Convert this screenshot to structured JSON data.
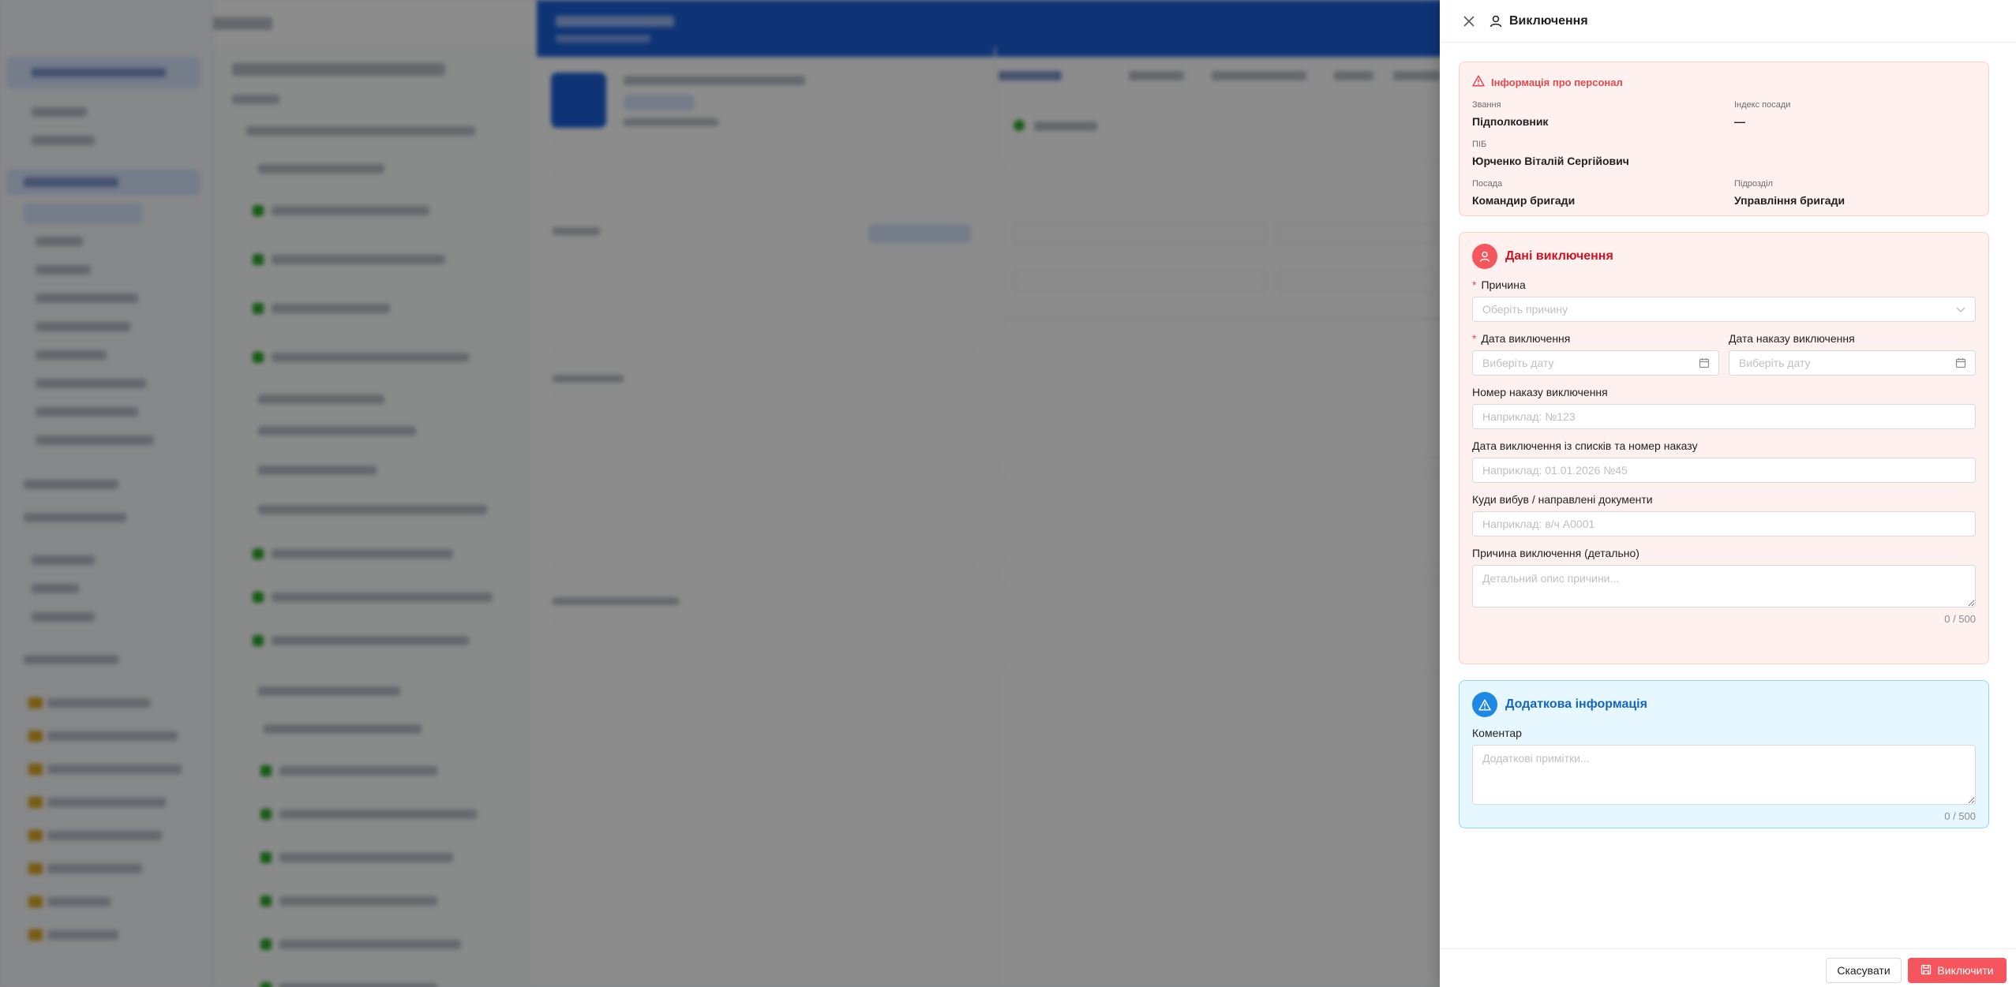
{
  "drawer": {
    "title": "Виключення",
    "personnel": {
      "heading": "Інформація про персонал",
      "rank_label": "Звання",
      "rank_value": "Підполковник",
      "position_index_label": "Індекс посади",
      "position_index_value": "—",
      "name_label": "ПІБ",
      "name_value": "Юрченко Віталій Сергійович",
      "position_label": "Посада",
      "position_value": "Командир бригади",
      "unit_label": "Підрозділ",
      "unit_value": "Управління бригади"
    },
    "exclusion": {
      "heading": "Дані виключення",
      "reason_label": "Причина",
      "reason_placeholder": "Оберіть причину",
      "date_label": "Дата виключення",
      "date_placeholder": "Виберіть дату",
      "order_date_label": "Дата наказу виключення",
      "order_date_placeholder": "Виберіть дату",
      "order_number_label": "Номер наказу виключення",
      "order_number_placeholder": "Наприклад: №123",
      "list_date_label": "Дата виключення із списків та номер наказу",
      "list_date_placeholder": "Наприклад: 01.01.2026 №45",
      "destination_label": "Куди вибув / направлені документи",
      "destination_placeholder": "Наприклад: в/ч А0001",
      "detail_label": "Причина виключення (детально)",
      "detail_placeholder": "Детальний опис причини...",
      "detail_counter": "0 / 500"
    },
    "extra": {
      "heading": "Додаткова інформація",
      "comment_label": "Коментар",
      "comment_placeholder": "Додаткові примітки...",
      "comment_counter": "0 / 500"
    },
    "footer": {
      "cancel_label": "Скасувати",
      "submit_label": "Виключити"
    }
  },
  "colors": {
    "danger": "#f5555c",
    "danger_bg": "#fff1f0",
    "info_bg": "#e6f7ff",
    "info_accent": "#1e88e5",
    "modal_header": "#1a5fd8"
  },
  "icons": [
    "close-icon",
    "user-icon",
    "warning-icon",
    "chevron-down-icon",
    "calendar-icon",
    "save-icon"
  ]
}
